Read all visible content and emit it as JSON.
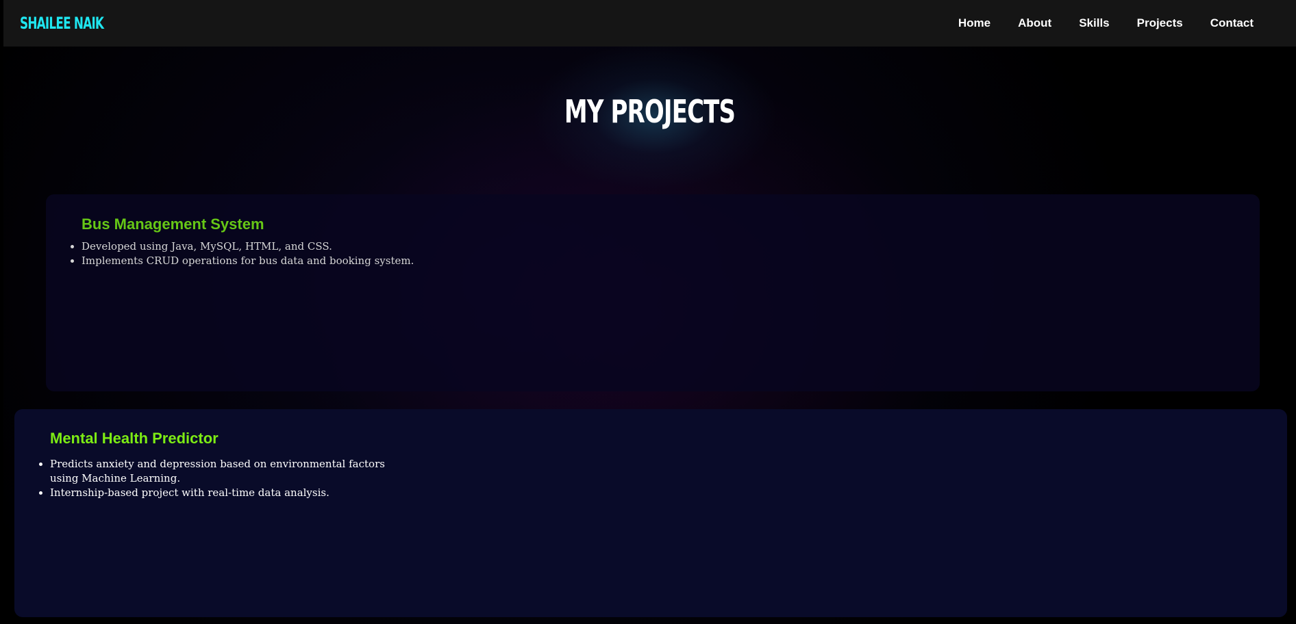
{
  "header": {
    "logo": "SHAILEE NAIK",
    "nav": [
      "Home",
      "About",
      "Skills",
      "Projects",
      "Contact"
    ]
  },
  "page_title": "MY PROJECTS",
  "projects": [
    {
      "title": "Bus Management System",
      "bullets": [
        "Developed using Java, MySQL, HTML, and CSS.",
        "Implements CRUD operations for bus data and booking system."
      ]
    },
    {
      "title": "Mental Health Predictor",
      "bullets": [
        "Predicts anxiety and depression based on environmental factors using Machine Learning.",
        "Internship-based project with real-time data analysis."
      ]
    }
  ],
  "colors": {
    "logo": "#1fe6f0",
    "project_title_1": "#66c716",
    "project_title_2": "#7dec14",
    "header_bg": "#151515"
  }
}
